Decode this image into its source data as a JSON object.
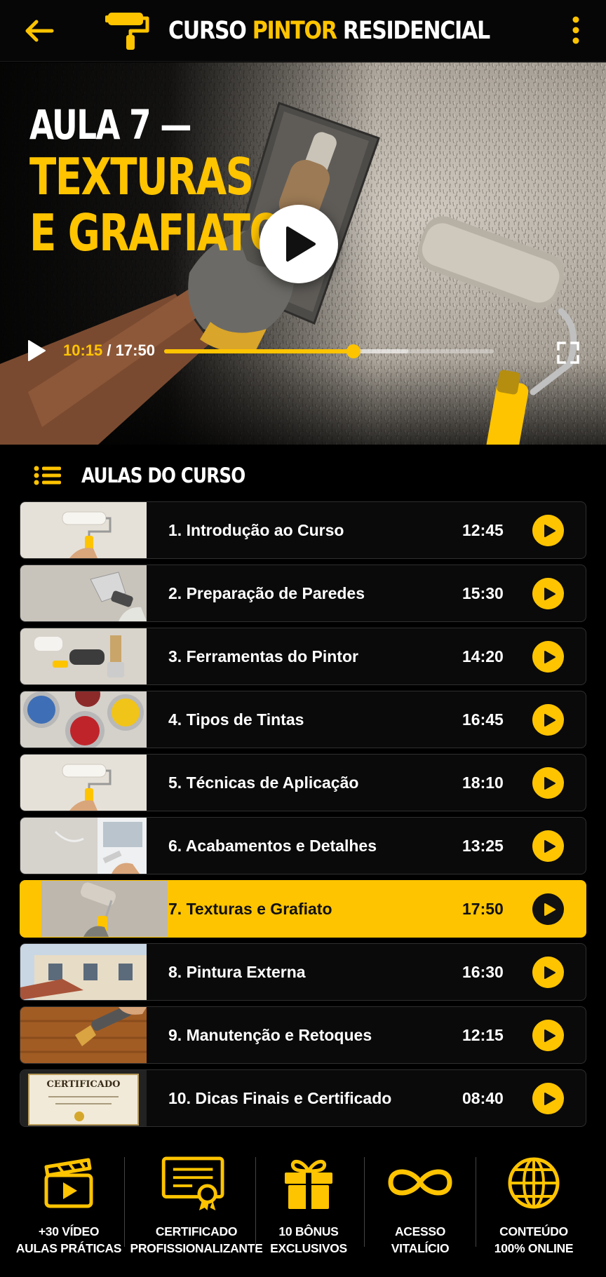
{
  "header": {
    "title_part1": "CURSO",
    "title_highlight": "PINTOR",
    "title_part3": "RESIDENCIAL",
    "back_icon": "arrow-left-icon",
    "logo_icon": "paint-roller-icon",
    "menu_icon": "more-vertical-icon"
  },
  "video": {
    "title_line1": "AULA 7 —",
    "title_line2": "TEXTURAS",
    "title_line3": "E GRAFIATO",
    "current_time": "10:15",
    "separator": "/",
    "duration": "17:50",
    "progress_fraction": 0.575,
    "buffered_fraction": 0.74
  },
  "lessons_section": {
    "title": "AULAS DO CURSO",
    "items": [
      {
        "label": "1. Introdução ao Curso",
        "duration": "12:45",
        "active": false,
        "thumb": "roller-wall"
      },
      {
        "label": "2. Preparação de Paredes",
        "duration": "15:30",
        "active": false,
        "thumb": "spatula"
      },
      {
        "label": "3. Ferramentas do Pintor",
        "duration": "14:20",
        "active": false,
        "thumb": "tools"
      },
      {
        "label": "4. Tipos de Tintas",
        "duration": "16:45",
        "active": false,
        "thumb": "paint-cans"
      },
      {
        "label": "5. Técnicas de Aplicação",
        "duration": "18:10",
        "active": false,
        "thumb": "roller-wall"
      },
      {
        "label": "6. Acabamentos e Detalhes",
        "duration": "13:25",
        "active": false,
        "thumb": "brush-corner"
      },
      {
        "label": "7. Texturas e Grafiato",
        "duration": "17:50",
        "active": true,
        "thumb": "texture-roller"
      },
      {
        "label": "8. Pintura Externa",
        "duration": "16:30",
        "active": false,
        "thumb": "house"
      },
      {
        "label": "9. Manutenção e Retoques",
        "duration": "12:15",
        "active": false,
        "thumb": "brush-wood"
      },
      {
        "label": "10. Dicas Finais e Certificado",
        "duration": "08:40",
        "active": false,
        "thumb": "certificate"
      }
    ]
  },
  "certificate_thumb_text": "CERTIFICADO",
  "features": [
    {
      "icon": "clapperboard-icon",
      "line1": "+30 VÍDEO",
      "line2": "AULAS PRÁTICAS"
    },
    {
      "icon": "certificate-icon",
      "line1": "CERTIFICADO",
      "line2": "PROFISSIONALIZANTE"
    },
    {
      "icon": "gift-icon",
      "line1": "10 BÔNUS",
      "line2": "EXCLUSIVOS"
    },
    {
      "icon": "infinity-icon",
      "line1": "ACESSO",
      "line2": "VITALÍCIO"
    },
    {
      "icon": "globe-icon",
      "line1": "CONTEÚDO",
      "line2": "100% ONLINE"
    }
  ],
  "colors": {
    "accent": "#ffc400",
    "background": "#000000",
    "card_border": "#2f2f2f"
  }
}
